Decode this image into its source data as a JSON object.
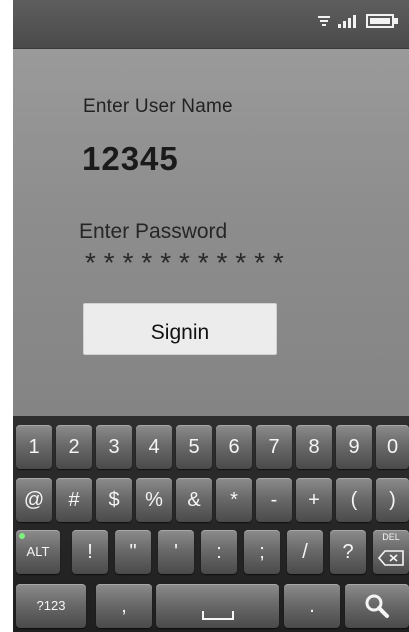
{
  "status_bar": {
    "icons": [
      "wifi-icon",
      "signal-icon",
      "battery-icon"
    ]
  },
  "login": {
    "username_label": "Enter User Name",
    "username_value": "12345",
    "password_label": "Enter Password",
    "password_value": "***********",
    "signin_label": "Signin"
  },
  "keyboard": {
    "row1": [
      "1",
      "2",
      "3",
      "4",
      "5",
      "6",
      "7",
      "8",
      "9",
      "0"
    ],
    "row2": [
      "@",
      "#",
      "$",
      "%",
      "&",
      "*",
      "-",
      "+",
      "(",
      ")"
    ],
    "row3": [
      "ALT",
      "!",
      "\"",
      "'",
      ":",
      ";",
      "/",
      "?"
    ],
    "del_label": "DEL",
    "row4": {
      "symbols_key": "?123",
      "comma": ",",
      "period": ".",
      "search_icon": "search-icon"
    }
  },
  "colors": {
    "background": "#8a8a8a",
    "status_bar": "#4a4a4a",
    "button": "#ececec",
    "keyboard": "#262626",
    "key": "#6a6a6a",
    "alt_indicator": "#7ef07e"
  }
}
